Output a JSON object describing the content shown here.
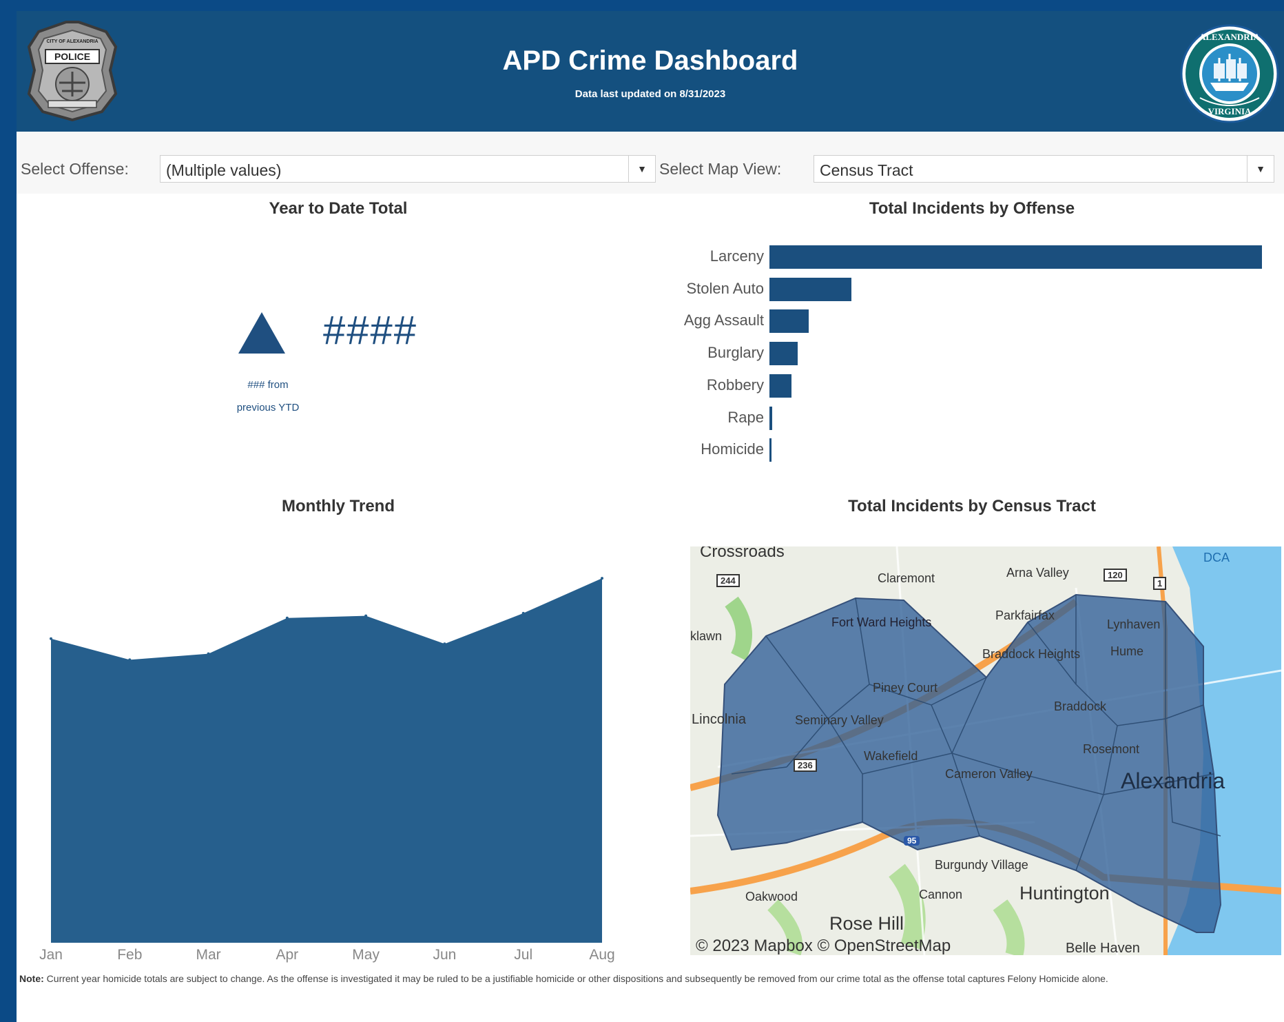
{
  "header": {
    "title": "APD Crime Dashboard",
    "subtitle": "Data last updated on 8/31/2023",
    "left_logo_text": [
      "CITY OF ALEXANDRIA",
      "POLICE"
    ],
    "right_logo_text": "CITY OF ALEXANDRIA VIRGINIA",
    "bg_color": "#14507f"
  },
  "filters": {
    "offense_label": "Select Offense:",
    "offense_value": "(Multiple values)",
    "mapview_label": "Select Map View:",
    "mapview_value": "Census Tract"
  },
  "ytd": {
    "title": "Year to Date Total",
    "value": "####",
    "change_line1": "### from",
    "change_line2": "previous YTD",
    "direction_icon": "triangle-up-icon",
    "accent": "#1f4f80"
  },
  "offense_chart": {
    "title": "Total Incidents by Offense",
    "chart_data": {
      "type": "bar",
      "orientation": "horizontal",
      "categories": [
        "Larceny",
        "Stolen Auto",
        "Agg Assault",
        "Burglary",
        "Robbery",
        "Rape",
        "Homicide"
      ],
      "values": [
        100,
        16.7,
        8,
        5.8,
        4.5,
        0.5,
        0.4
      ],
      "bar_color": "#1b4f7e",
      "grid": false
    }
  },
  "monthly": {
    "title": "Monthly Trend",
    "chart_data": {
      "type": "area",
      "categories": [
        "Jan",
        "Feb",
        "Mar",
        "Apr",
        "May",
        "Jun",
        "Jul",
        "Aug"
      ],
      "values": [
        70.5,
        65.6,
        67,
        75.3,
        75.8,
        69.3,
        76.4,
        84.5
      ],
      "ylim": [
        0,
        85
      ],
      "fill_color": "#265f8d",
      "grid": false
    }
  },
  "map": {
    "title": "Total Incidents by Census Tract",
    "attribution": "© 2023 Mapbox © OpenStreetMap",
    "labels": [
      "Crossroads",
      "Claremont",
      "Arna Valley",
      "DCA",
      "Fort Ward Heights",
      "Parkfairfax",
      "Lynhaven",
      "klawn",
      "Braddock Heights",
      "Hume",
      "Piney Court",
      "Braddock",
      "Lincolnia",
      "Seminary Valley",
      "Wakefield",
      "Rosemont",
      "Cameron Valley",
      "Alexandria",
      "Burgundy Village",
      "Oakwood",
      "Cannon",
      "Huntington",
      "Rose Hill",
      "Belle Haven"
    ],
    "shield_labels": [
      "244",
      "120",
      "1",
      "236",
      "95"
    ],
    "overlay_color": "#2f5f97"
  },
  "note": {
    "label": "Note:",
    "text": "Current year homicide totals are subject to change. As the offense is investigated it may be ruled to be a justifiable homicide or other dispositions and subsequently be removed from our crime total as the offense total captures Felony Homicide alone."
  }
}
